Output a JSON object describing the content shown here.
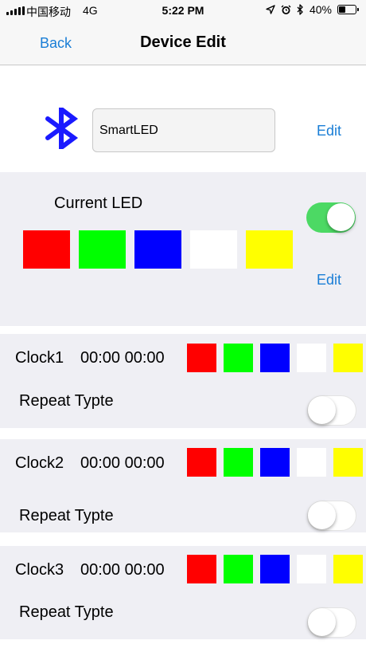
{
  "status_bar": {
    "carrier": "中国移动",
    "network": "4G",
    "time": "5:22 PM",
    "battery": "40%",
    "battery_level": 0.4
  },
  "nav": {
    "back_label": "Back",
    "title": "Device Edit"
  },
  "device": {
    "name_value": "SmartLED",
    "edit_label": "Edit"
  },
  "current_led": {
    "label": "Current LED",
    "toggle_on": true,
    "colors": [
      "#ff0000",
      "#00ff00",
      "#0000ff",
      "#ffffff",
      "#ffff00"
    ],
    "edit_label": "Edit"
  },
  "clocks": [
    {
      "name": "Clock1",
      "times": "00:00 00:00",
      "colors": [
        "#ff0000",
        "#00ff00",
        "#0000ff",
        "#ffffff",
        "#ffff00"
      ],
      "repeat_label": "Repeat Typte",
      "toggle_on": false
    },
    {
      "name": "Clock2",
      "times": "00:00 00:00",
      "colors": [
        "#ff0000",
        "#00ff00",
        "#0000ff",
        "#ffffff",
        "#ffff00"
      ],
      "repeat_label": "Repeat Typte",
      "toggle_on": false
    },
    {
      "name": "Clock3",
      "times": "00:00 00:00",
      "colors": [
        "#ff0000",
        "#00ff00",
        "#0000ff",
        "#ffffff",
        "#ffff00"
      ],
      "repeat_label": "Repeat Typte",
      "toggle_on": false
    }
  ],
  "colors": {
    "accent": "#1a7ed6",
    "toggle_on": "#4cd964",
    "bluetooth": "#1a1aff",
    "panel_bg": "#efeff4"
  }
}
